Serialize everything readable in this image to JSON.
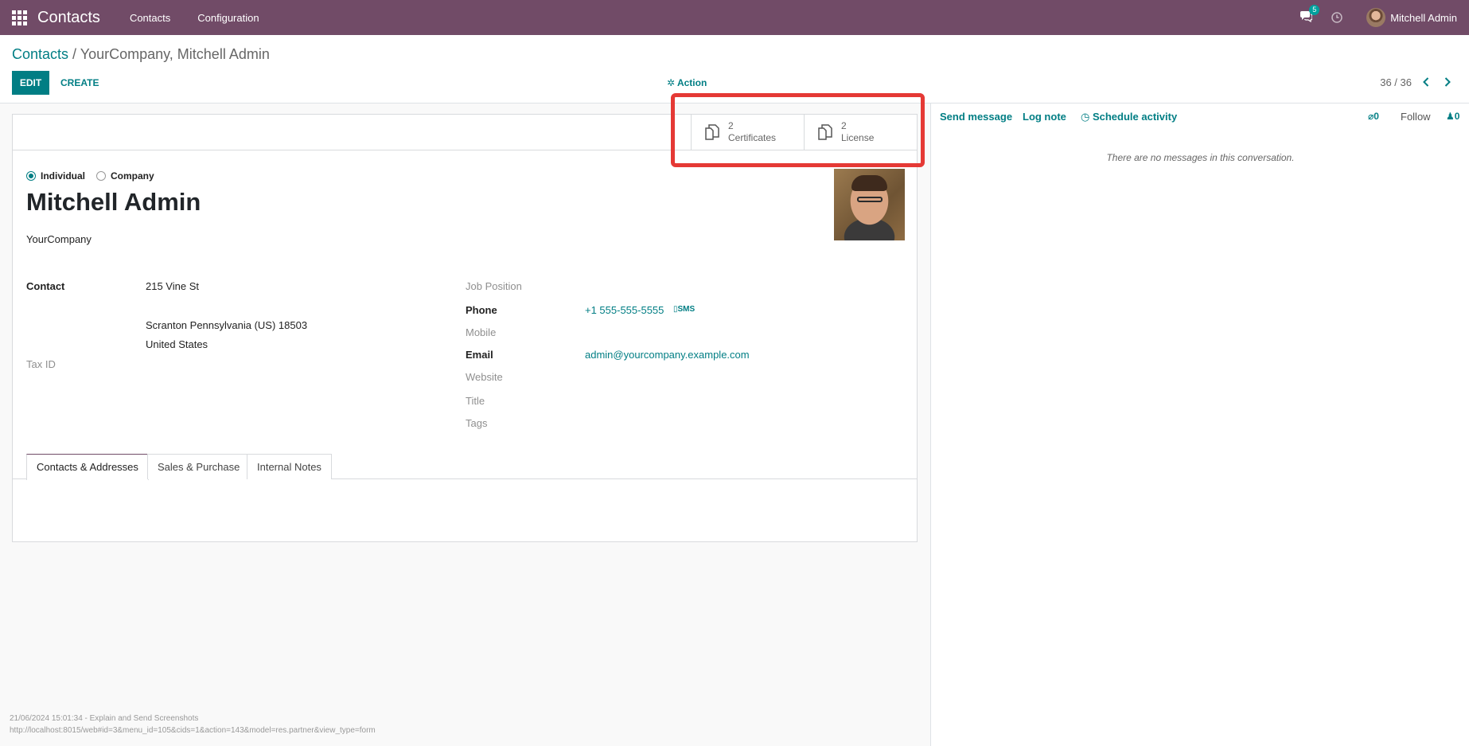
{
  "navbar": {
    "app_title": "Contacts",
    "menu": [
      "Contacts",
      "Configuration"
    ],
    "chat_badge": "5",
    "user_name": "Mitchell Admin"
  },
  "breadcrumb": {
    "root": "Contacts",
    "separator": " / ",
    "current": "YourCompany, Mitchell Admin"
  },
  "toolbar": {
    "edit_label": "EDIT",
    "create_label": "CREATE",
    "action_label": "Action"
  },
  "pager": {
    "value": "36 / 36"
  },
  "stat_buttons": [
    {
      "value": "2",
      "label": "Certificates"
    },
    {
      "value": "2",
      "label": "License"
    }
  ],
  "partner": {
    "type_options": [
      "Individual",
      "Company"
    ],
    "selected_type": "Individual",
    "name": "Mitchell Admin",
    "parent_company": "YourCompany"
  },
  "fields_left": {
    "contact_label": "Contact",
    "street": "215 Vine St",
    "city_line": "Scranton  Pennsylvania (US)  18503",
    "country": "United States",
    "tax_id_label": "Tax ID"
  },
  "fields_right": {
    "job_position_label": "Job Position",
    "phone_label": "Phone",
    "phone_value": "+1 555-555-5555",
    "sms_label": "SMS",
    "mobile_label": "Mobile",
    "email_label": "Email",
    "email_value": "admin@yourcompany.example.com",
    "website_label": "Website",
    "title_label": "Title",
    "tags_label": "Tags"
  },
  "tabs": [
    "Contacts & Addresses",
    "Sales & Purchase",
    "Internal Notes"
  ],
  "chatter": {
    "send_message": "Send message",
    "log_note": "Log note",
    "schedule_activity": "Schedule activity",
    "attachments_count": "0",
    "follow": "Follow",
    "followers_count": "0",
    "empty_text": "There are no messages in this conversation."
  },
  "footer": {
    "line1": "21/06/2024 15:01:34 - Explain and Send Screenshots",
    "line2": "http://localhost:8015/web#id=3&menu_id=105&cids=1&action=143&model=res.partner&view_type=form"
  },
  "colors": {
    "brand": "#714b67",
    "accent": "#017e84",
    "highlight": "#e53935"
  }
}
